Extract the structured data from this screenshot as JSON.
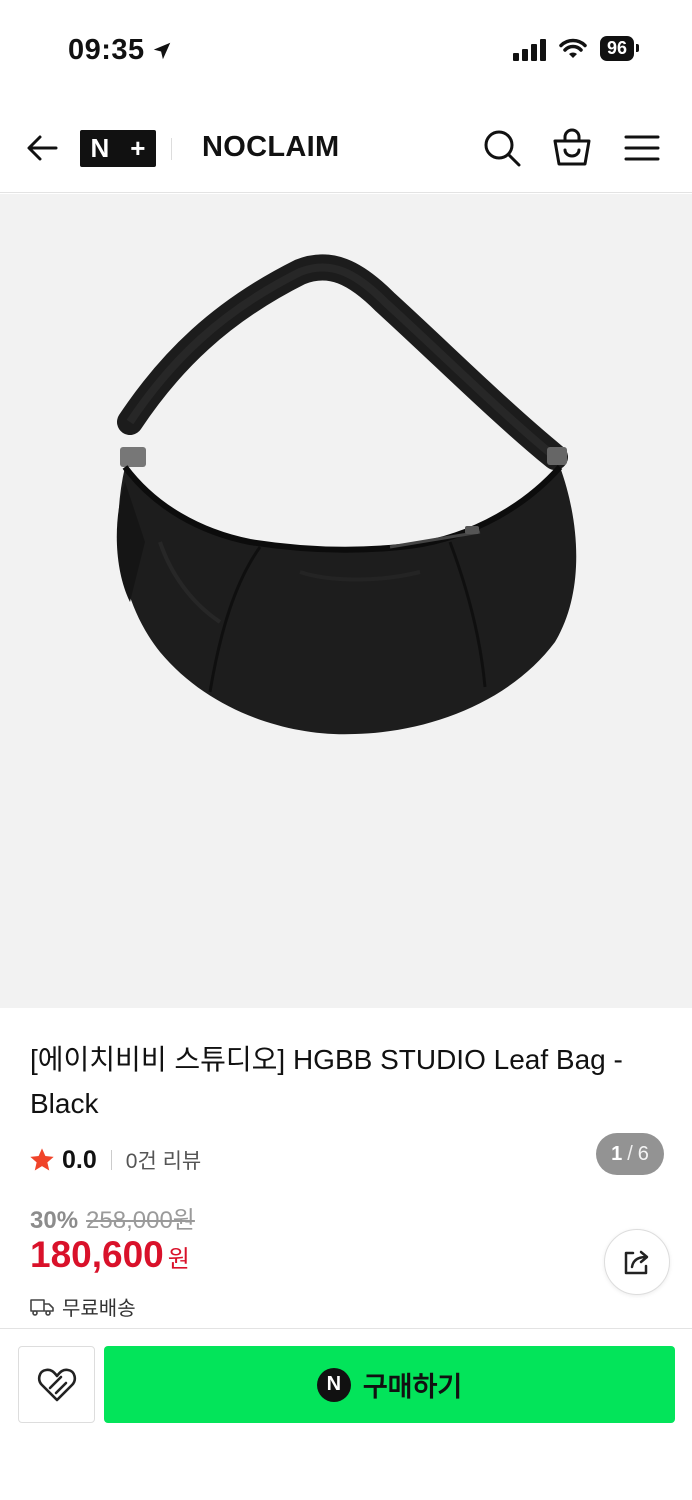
{
  "status_bar": {
    "time": "09:35",
    "battery": "96"
  },
  "header": {
    "badge_left": "N",
    "badge_right": "+",
    "brand_name": "NOCLAIM",
    "icons": [
      "back-arrow-icon",
      "search-icon",
      "shopping-bag-icon",
      "menu-icon"
    ]
  },
  "gallery": {
    "current": "1",
    "separator": "/",
    "total": "6"
  },
  "product": {
    "title": "[에이치비비 스튜디오] HGBB STUDIO Leaf Bag - Black",
    "rating": "0.0",
    "review_count": "0건 리뷰",
    "discount": "30%",
    "original_price": "258,000원",
    "price": "180,600",
    "price_unit": "원",
    "shipping": "무료배송"
  },
  "bottom_bar": {
    "npay_letter": "N",
    "buy_label": "구매하기"
  },
  "colors": {
    "accent_green": "#03e45a",
    "price_red": "#d9112a",
    "star": "#f0442a"
  }
}
